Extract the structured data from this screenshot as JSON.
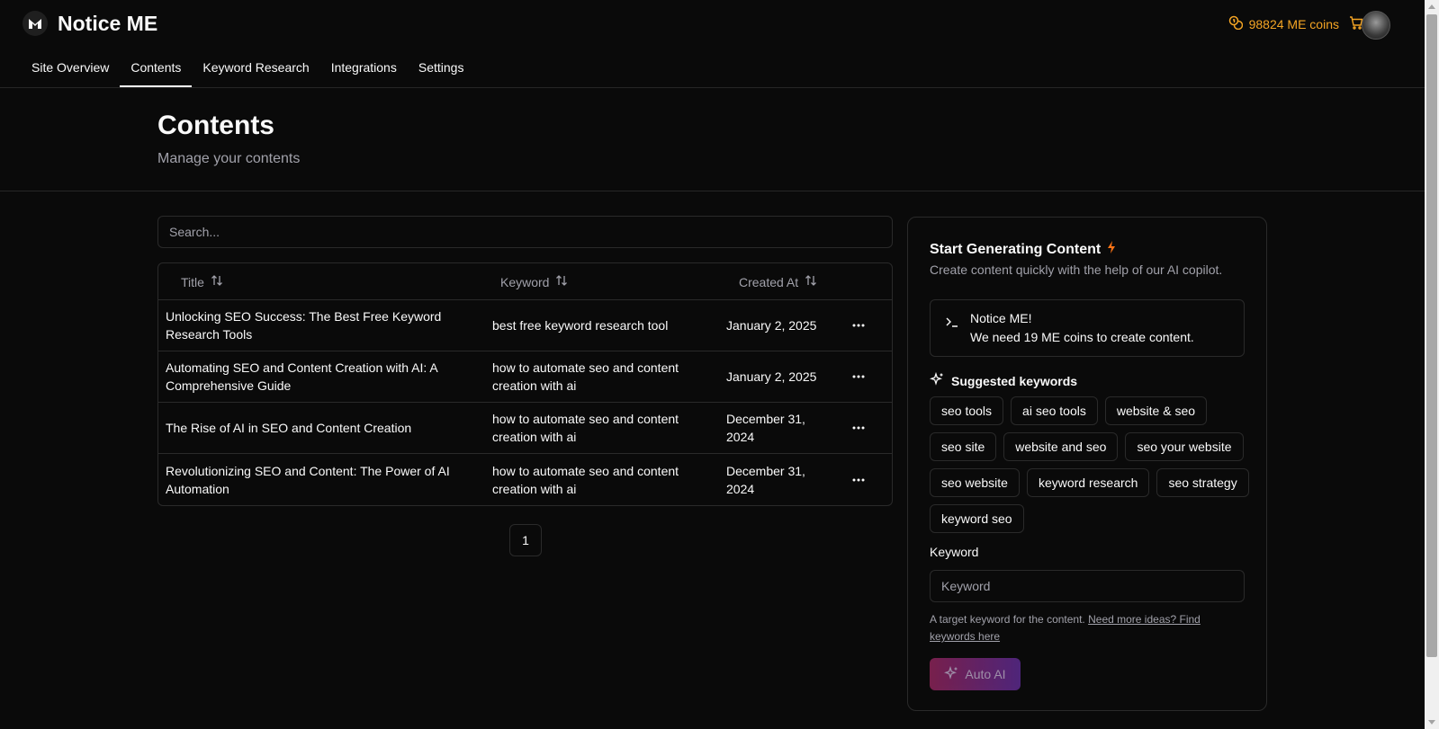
{
  "app": {
    "brand": "Notice ME",
    "coins_label": "98824 ME coins"
  },
  "nav": [
    {
      "label": "Site Overview",
      "active": false
    },
    {
      "label": "Contents",
      "active": true
    },
    {
      "label": "Keyword Research",
      "active": false
    },
    {
      "label": "Integrations",
      "active": false
    },
    {
      "label": "Settings",
      "active": false
    }
  ],
  "page": {
    "title": "Contents",
    "subtitle": "Manage your contents"
  },
  "search": {
    "placeholder": "Search..."
  },
  "table": {
    "columns": [
      "Title",
      "Keyword",
      "Created At"
    ],
    "rows": [
      {
        "title": "Unlocking SEO Success: The Best Free Keyword Research Tools",
        "keyword": "best free keyword research tool",
        "created": "January 2, 2025"
      },
      {
        "title": "Automating SEO and Content Creation with AI: A Comprehensive Guide",
        "keyword": "how to automate seo and content creation with ai",
        "created": "January 2, 2025"
      },
      {
        "title": "The Rise of AI in SEO and Content Creation",
        "keyword": "how to automate seo and content creation with ai",
        "created": "December 31, 2024"
      },
      {
        "title": "Revolutionizing SEO and Content: The Power of AI Automation",
        "keyword": "how to automate seo and content creation with ai",
        "created": "December 31, 2024"
      }
    ]
  },
  "pagination": {
    "current": "1"
  },
  "generator": {
    "title": "Start Generating Content",
    "subtitle": "Create content quickly with the help of our AI copilot.",
    "alert_title": "Notice ME!",
    "alert_desc": "We need 19 ME coins to create content.",
    "suggested_title": "Suggested keywords",
    "suggestions": [
      "seo tools",
      "ai seo tools",
      "website & seo",
      "seo site",
      "website and seo",
      "seo your website",
      "seo website",
      "keyword research",
      "seo strategy",
      "keyword seo"
    ],
    "keyword_label": "Keyword",
    "keyword_placeholder": "Keyword",
    "help_text": "A target keyword for the content.",
    "help_link": "Need more ideas? Find keywords here",
    "button_label": "Auto AI"
  },
  "colors": {
    "accent": "#f5a524",
    "background": "#0a0a0a",
    "border": "#2a2a2a",
    "muted": "#a1a1aa"
  },
  "icons": [
    "logo-icon",
    "coins-icon",
    "cart-icon",
    "sort-icon",
    "more-horizontal-icon",
    "lightning-icon",
    "terminal-icon",
    "sparkles-icon"
  ]
}
